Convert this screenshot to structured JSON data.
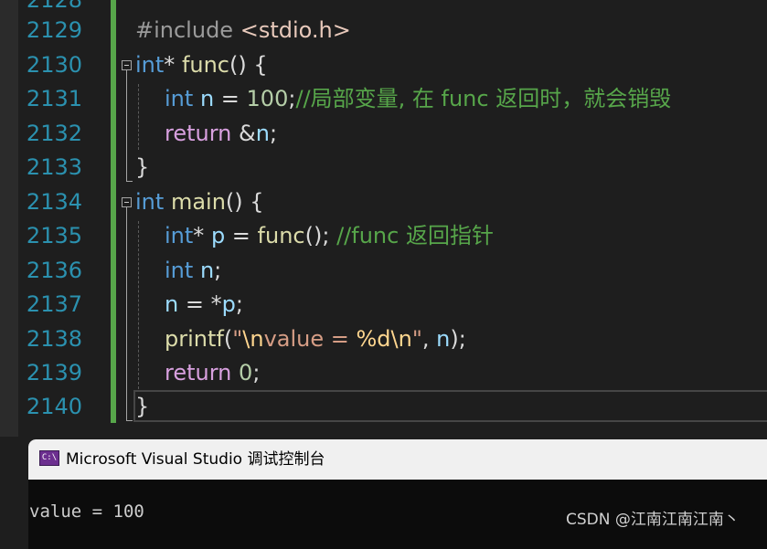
{
  "colors": {
    "editor_bg": "#1e1e1e",
    "line_number": "#2b91af",
    "keyword": "#569cd6",
    "control_keyword": "#d8a0df",
    "function": "#dcdcaa",
    "variable": "#9cdcfe",
    "number": "#b5cea8",
    "string": "#d69d85",
    "escape": "#ffd68f",
    "comment": "#57a64a",
    "change_bar": "#57a64a",
    "console_bg": "#0c0c0c",
    "console_titlebar": "#f0f0f0"
  },
  "editor": {
    "partial_top_line": "2128",
    "lines": [
      {
        "num": "2129",
        "tokens": {
          "pp": "#include ",
          "hdr": "<stdio.h>"
        }
      },
      {
        "num": "2130",
        "tokens": {
          "kw": "int",
          "p1": "* ",
          "fn": "func",
          "p2": "() {"
        }
      },
      {
        "num": "2131",
        "tokens": {
          "kw": "int",
          "sp": " ",
          "var": "n",
          "p1": " = ",
          "num": "100",
          "p2": ";",
          "cmt": "//局部变量, 在 func 返回时，就会销毁"
        }
      },
      {
        "num": "2132",
        "tokens": {
          "ctl": "return",
          "p1": " &",
          "var": "n",
          "p2": ";"
        }
      },
      {
        "num": "2133",
        "tokens": {
          "p1": "}"
        }
      },
      {
        "num": "2134",
        "tokens": {
          "kw": "int",
          "sp": " ",
          "fn": "main",
          "p2": "() {"
        }
      },
      {
        "num": "2135",
        "tokens": {
          "kw": "int",
          "p1": "* ",
          "var": "p",
          "p2": " = ",
          "fn": "func",
          "p3": "(); ",
          "cmt": "//func 返回指针"
        }
      },
      {
        "num": "2136",
        "tokens": {
          "kw": "int",
          "sp": " ",
          "var": "n",
          "p1": ";"
        }
      },
      {
        "num": "2137",
        "tokens": {
          "var": "n",
          "p1": " = *",
          "var2": "p",
          "p2": ";"
        }
      },
      {
        "num": "2138",
        "tokens": {
          "fn": "printf",
          "p1": "(",
          "str1": "\"",
          "esc1": "\\n",
          "str2": "value = ",
          "esc2": "%d",
          "esc3": "\\n",
          "str3": "\"",
          "p2": ", ",
          "var": "n",
          "p3": ");"
        }
      },
      {
        "num": "2139",
        "tokens": {
          "ctl": "return",
          "sp": " ",
          "num": "0",
          "p1": ";"
        }
      },
      {
        "num": "2140",
        "tokens": {
          "p1": "}"
        }
      }
    ]
  },
  "console": {
    "icon_glyph": "C:\\",
    "icon_name": "console-app-icon",
    "title": "Microsoft Visual Studio 调试控制台",
    "output": "value = 100"
  },
  "watermark": "CSDN @江南江南江南丶"
}
